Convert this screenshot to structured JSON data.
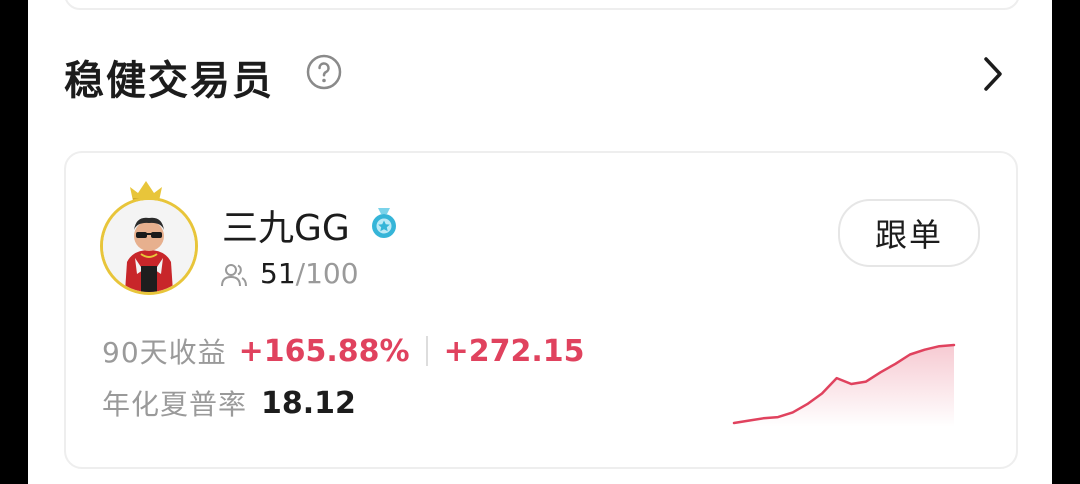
{
  "section": {
    "title": "稳健交易员"
  },
  "trader": {
    "name": "三九GG",
    "copiers_current": "51",
    "copiers_max": "/100",
    "follow_label": "跟单"
  },
  "metrics": {
    "return_label": "90天收益",
    "return_pct": "+165.88%",
    "return_abs": "+272.15",
    "sharpe_label": "年化夏普率",
    "sharpe_value": "18.12"
  },
  "chart_data": {
    "type": "area",
    "trend": "up",
    "y": [
      2,
      4,
      6,
      7,
      11,
      18,
      27,
      40,
      35,
      37,
      45,
      52,
      60,
      64,
      67,
      68
    ],
    "color": "#e0425e"
  },
  "colors": {
    "accent_positive": "#e0425e",
    "crown": "#e8c53a",
    "badge": "#36b5d8"
  }
}
